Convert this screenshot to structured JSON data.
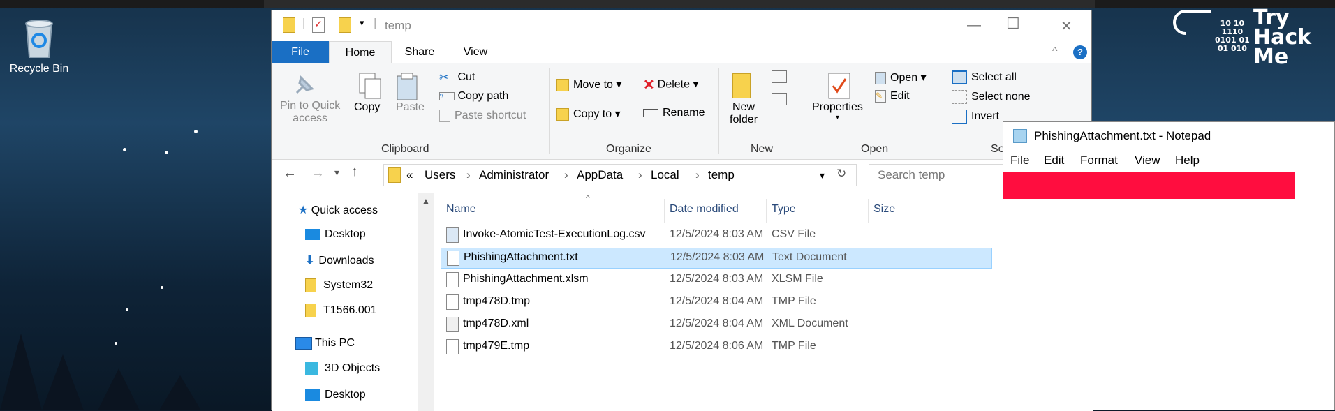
{
  "desktop": {
    "recycle_bin_label": "Recycle Bin",
    "logo": {
      "binary": "10 10\n1110\n0101 01\n01 010",
      "word1": "Try",
      "word2": "Hack",
      "word3": "Me"
    }
  },
  "explorer": {
    "title": "temp",
    "tabs": {
      "file": "File",
      "home": "Home",
      "share": "Share",
      "view": "View"
    },
    "clipboard": {
      "pin": "Pin to Quick",
      "pin2": "access",
      "copy": "Copy",
      "paste": "Paste",
      "cut": "Cut",
      "copy_path": "Copy path",
      "paste_shortcut": "Paste shortcut",
      "group": "Clipboard"
    },
    "organize": {
      "move_to": "Move to",
      "copy_to": "Copy to",
      "delete": "Delete",
      "rename": "Rename",
      "group": "Organize"
    },
    "new": {
      "new_folder": "New",
      "new_folder2": "folder",
      "group": "New"
    },
    "open": {
      "properties": "Properties",
      "open": "Open",
      "edit": "Edit",
      "group": "Open"
    },
    "select": {
      "select_all": "Select all",
      "select_none": "Select none",
      "invert": "Invert",
      "group": "Sel"
    },
    "address": {
      "chevron": "«",
      "crumbs": [
        "Users",
        "Administrator",
        "AppData",
        "Local",
        "temp"
      ],
      "search_placeholder": "Search temp"
    },
    "nav": {
      "quick_access": "Quick access",
      "desktop": "Desktop",
      "downloads": "Downloads",
      "system32": "System32",
      "t1566": "T1566.001",
      "this_pc": "This PC",
      "objects": "3D Objects",
      "desktop2": "Desktop"
    },
    "columns": {
      "name": "Name",
      "date": "Date modified",
      "type": "Type",
      "size": "Size"
    },
    "files": [
      {
        "name": "Invoke-AtomicTest-ExecutionLog.csv",
        "date": "12/5/2024 8:03 AM",
        "type": "CSV File"
      },
      {
        "name": "PhishingAttachment.txt",
        "date": "12/5/2024 8:03 AM",
        "type": "Text Document"
      },
      {
        "name": "PhishingAttachment.xlsm",
        "date": "12/5/2024 8:03 AM",
        "type": "XLSM File"
      },
      {
        "name": "tmp478D.tmp",
        "date": "12/5/2024 8:04 AM",
        "type": "TMP File"
      },
      {
        "name": "tmp478D.xml",
        "date": "12/5/2024 8:04 AM",
        "type": "XML Document"
      },
      {
        "name": "tmp479E.tmp",
        "date": "12/5/2024 8:06 AM",
        "type": "TMP File"
      }
    ]
  },
  "notepad": {
    "title": "PhishingAttachment.txt - Notepad",
    "menu": {
      "file": "File",
      "edit": "Edit",
      "format": "Format",
      "view": "View",
      "help": "Help"
    }
  }
}
